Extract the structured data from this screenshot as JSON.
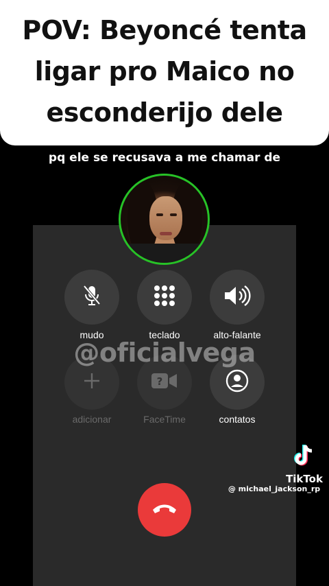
{
  "title_card": {
    "text": "POV: Beyoncé tenta ligar pro Maico no esconderijo dele"
  },
  "caption": "pq ele se recusava a me chamar de",
  "call": {
    "buttons": [
      {
        "label": "mudo",
        "icon": "mic-off-icon",
        "enabled": true
      },
      {
        "label": "teclado",
        "icon": "keypad-icon",
        "enabled": true
      },
      {
        "label": "alto-falante",
        "icon": "speaker-icon",
        "enabled": true
      },
      {
        "label": "adicionar",
        "icon": "plus-icon",
        "enabled": false
      },
      {
        "label": "FaceTime",
        "icon": "facetime-icon",
        "enabled": false
      },
      {
        "label": "contatos",
        "icon": "contacts-icon",
        "enabled": true
      }
    ],
    "end_icon": "end-call-icon",
    "end_color": "#ea3a3a",
    "avatar_ring_color": "#27c227"
  },
  "watermark": "@oficialvega",
  "tiktok": {
    "brand": "TikTok",
    "handle": "@ michael_jackson_rp"
  }
}
